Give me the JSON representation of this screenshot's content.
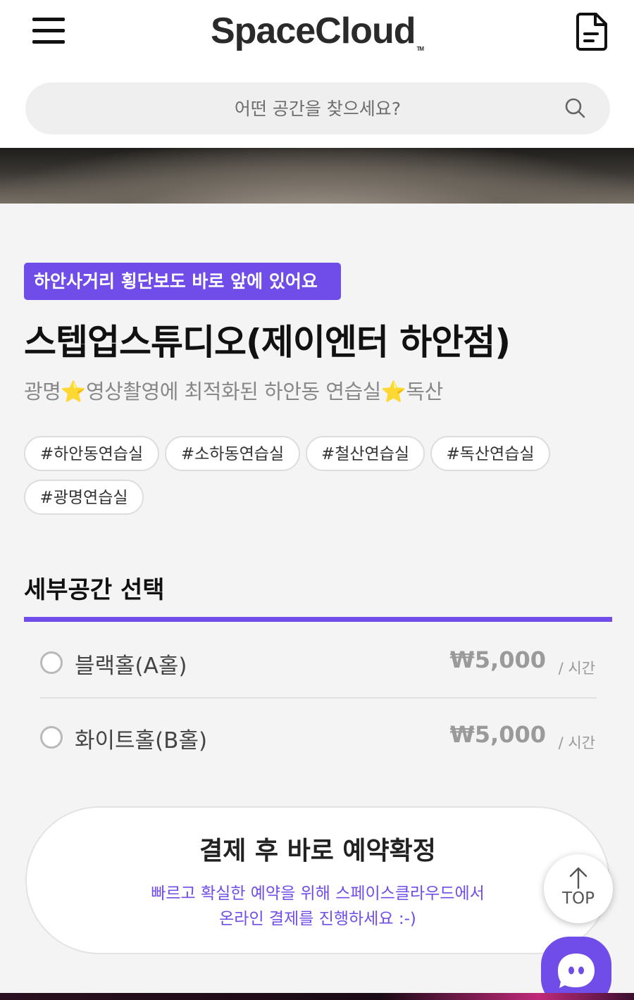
{
  "header": {
    "logo_text": "SpaceCloud",
    "logo_tm": "TM"
  },
  "search": {
    "placeholder": "어떤 공간을 찾으세요?"
  },
  "space": {
    "tagline": "하안사거리 횡단보도 바로 앞에 있어요",
    "title": "스텝업스튜디오(제이엔터 하안점)",
    "subtitle": "광명⭐영상촬영에 최적화된 하안동 연습실⭐독산",
    "tags": [
      "#하안동연습실",
      "#소하동연습실",
      "#철산연습실",
      "#독산연습실",
      "#광명연습실"
    ]
  },
  "subspace": {
    "title": "세부공간 선택",
    "options": [
      {
        "name": "블랙홀(A홀)",
        "price": "₩5,000",
        "unit": "/ 시간"
      },
      {
        "name": "화이트홀(B홀)",
        "price": "₩5,000",
        "unit": "/ 시간"
      }
    ]
  },
  "cta": {
    "title": "결제 후 바로 예약확정",
    "desc_line1": "빠르고 확실한 예약을 위해 스페이스클라우드에서",
    "desc_line2": "온라인 결제를 진행하세요 :-)"
  },
  "floating": {
    "top_label": "TOP"
  },
  "colors": {
    "accent": "#704de8"
  }
}
